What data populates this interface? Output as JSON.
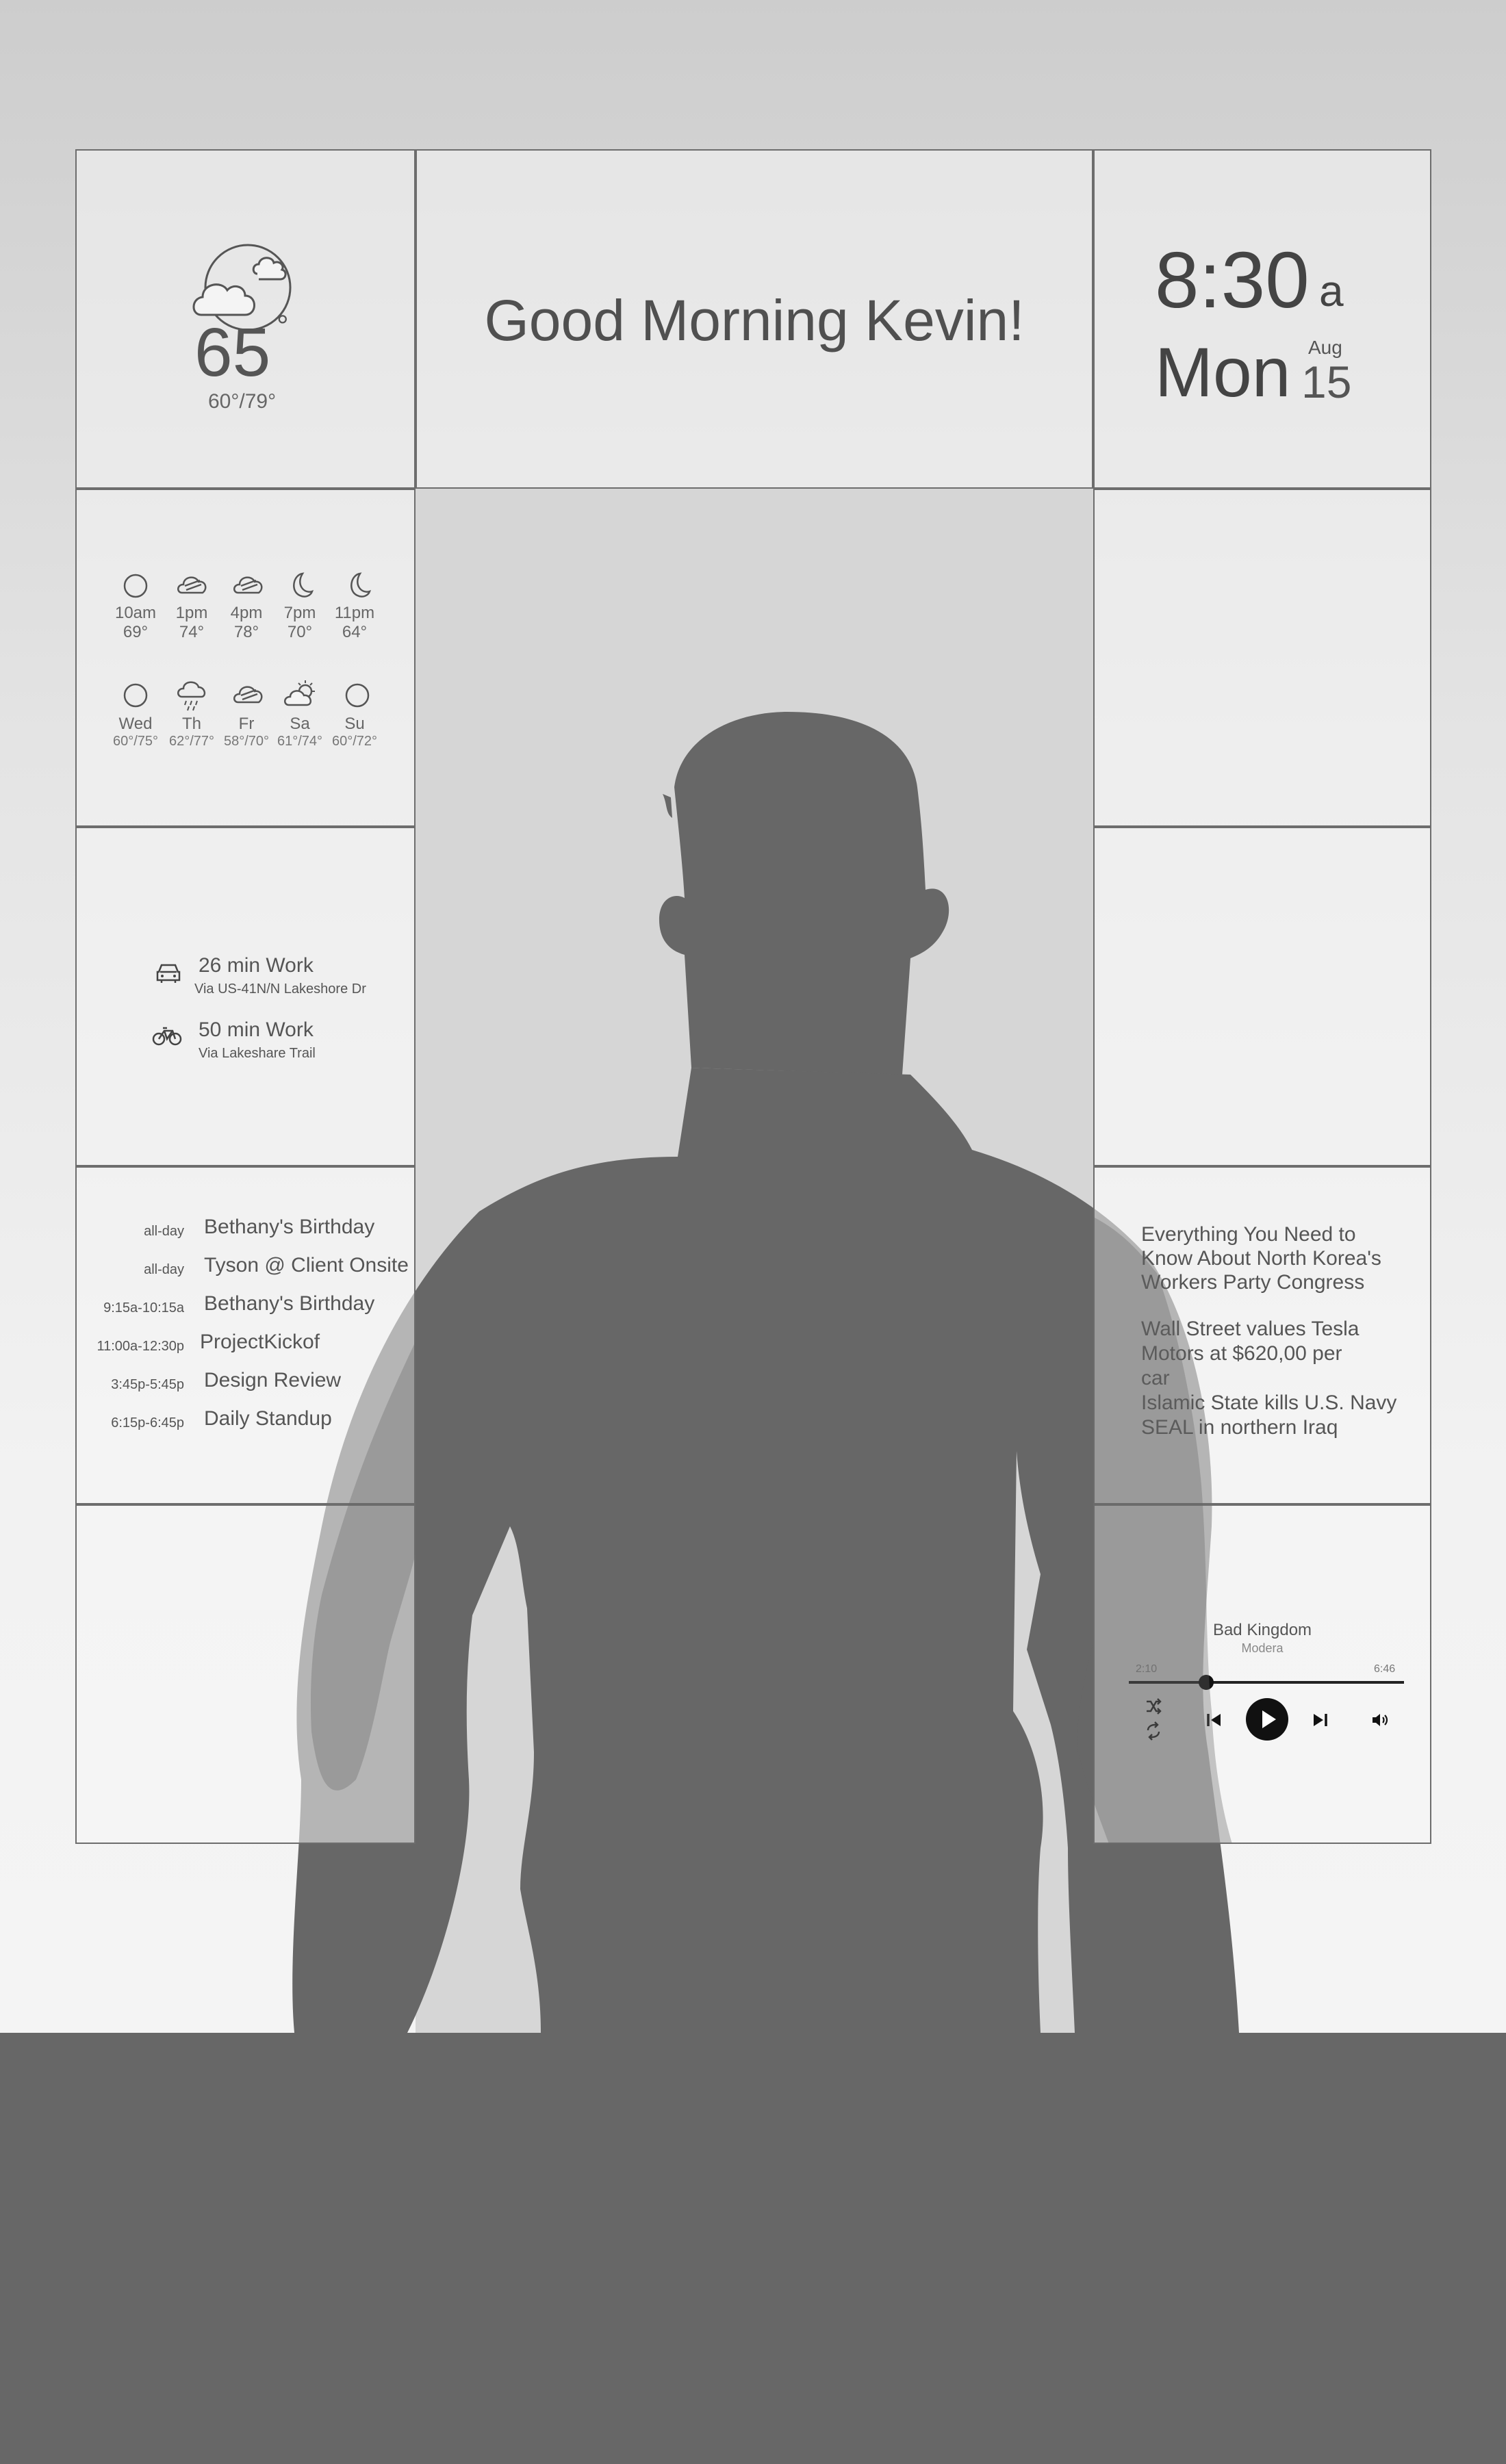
{
  "weather": {
    "temp": "65",
    "degree": "°",
    "range": "60°/79°",
    "icon": "partly-cloudy-night-icon"
  },
  "greeting": "Good Morning Kevin!",
  "clock": {
    "time": "8:30",
    "ampm": "a",
    "day": "Mon",
    "month": "Aug",
    "date": "15"
  },
  "hourly": [
    {
      "time": "10am",
      "temp": "69°",
      "icon": "clear-night-icon"
    },
    {
      "time": "1pm",
      "temp": "74°",
      "icon": "wind-cloud-icon"
    },
    {
      "time": "4pm",
      "temp": "78°",
      "icon": "wind-cloud-icon"
    },
    {
      "time": "7pm",
      "temp": "70°",
      "icon": "moon-icon"
    },
    {
      "time": "11pm",
      "temp": "64°",
      "icon": "moon-icon"
    }
  ],
  "daily": [
    {
      "day": "Wed",
      "range": "60°/75°",
      "icon": "clear-icon"
    },
    {
      "day": "Th",
      "range": "62°/77°",
      "icon": "rain-icon"
    },
    {
      "day": "Fr",
      "range": "58°/70°",
      "icon": "wind-cloud-icon"
    },
    {
      "day": "Sa",
      "range": "61°/74°",
      "icon": "partly-sunny-icon"
    },
    {
      "day": "Su",
      "range": "60°/72°",
      "icon": "clear-icon"
    }
  ],
  "commute": [
    {
      "time": "26 min Work",
      "via": "Via US-41N/N Lakeshore Dr",
      "icon": "car-icon"
    },
    {
      "time": "50 min Work",
      "via": "Via Lakeshare Trail",
      "icon": "bike-icon"
    }
  ],
  "calendar": [
    {
      "when": "all-day",
      "title": "Bethany's Birthday"
    },
    {
      "when": "all-day",
      "title": "Tyson @ Client Onsite"
    },
    {
      "when": "9:15a-10:15a",
      "title": "Bethany's Birthday"
    },
    {
      "when": "11:00a-12:30p",
      "title": "ProjectKickof"
    },
    {
      "when": "3:45p-5:45p",
      "title": "Design Review"
    },
    {
      "when": "6:15p-6:45p",
      "title": "Daily Standup"
    }
  ],
  "news": [
    "Everything You Need to Know About North Korea's Workers Party Congress",
    "Wall Street values Tesla Motors at $620,00 per car",
    "Islamic State kills U.S. Navy SEAL in northern Iraq"
  ],
  "music": {
    "title": "Bad Kingdom",
    "artist": "Modera",
    "elapsed": "2:10",
    "duration": "6:46",
    "progress": 0.28
  },
  "colors": {
    "frame": "#6d6d6d",
    "silhouette": "#676767",
    "text": "#444444"
  }
}
